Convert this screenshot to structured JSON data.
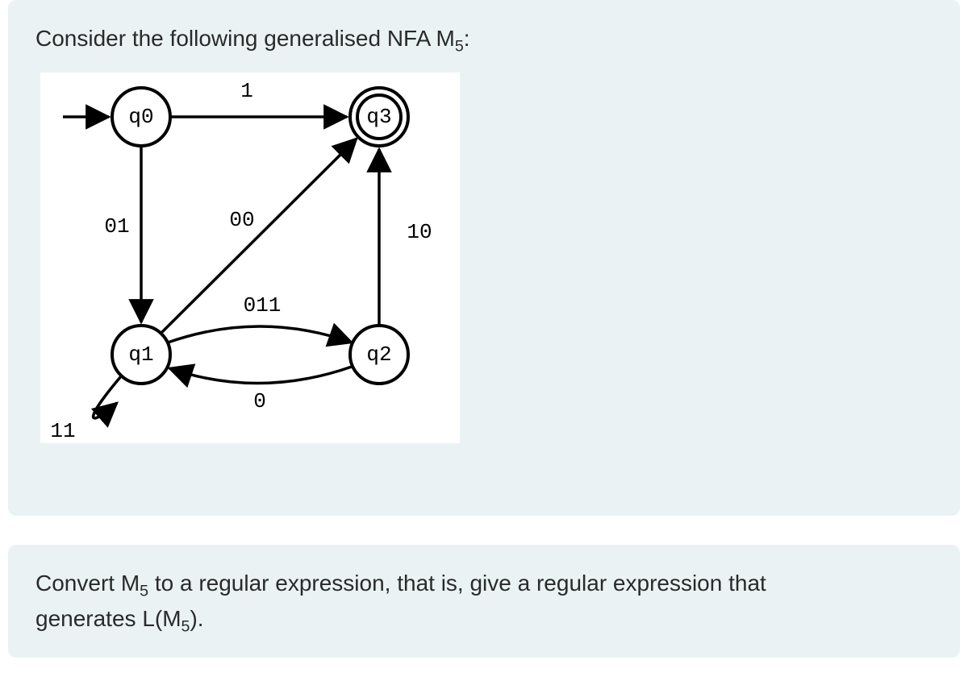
{
  "question": {
    "intro_prefix": "Consider the following generalised NFA M",
    "intro_sub": "5",
    "intro_suffix": ":",
    "convert_p1_prefix": "Convert M",
    "convert_p1_sub": "5",
    "convert_p1_mid": " to a regular expression, that is, give a regular expression that",
    "convert_p2_prefix": "generates L(M",
    "convert_p2_sub": "5",
    "convert_p2_suffix": ")."
  },
  "automaton": {
    "states": {
      "q0": "q0",
      "q1": "q1",
      "q2": "q2",
      "q3": "q3"
    },
    "edges": {
      "q0_q3": "1",
      "q0_q1": "01",
      "q1_q3": "00",
      "q1_q2": "011",
      "q2_q1": "0",
      "q2_q3": "10",
      "q1_q1": "11"
    }
  }
}
